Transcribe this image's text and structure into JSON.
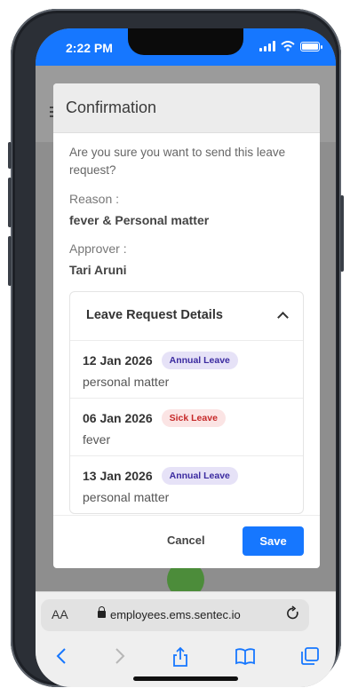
{
  "status_bar": {
    "time": "2:22 PM"
  },
  "modal": {
    "title": "Confirmation",
    "message": "Are you sure you want to send this leave request?",
    "reason_label": "Reason :",
    "reason_value": "fever & Personal matter",
    "approver_label": "Approver :",
    "approver_value": "Tari Aruni",
    "details": {
      "title": "Leave Request Details",
      "items": [
        {
          "date": "12 Jan 2026",
          "type": "Annual Leave",
          "note": "personal matter"
        },
        {
          "date": "06 Jan 2026",
          "type": "Sick Leave",
          "note": "fever"
        },
        {
          "date": "13 Jan 2026",
          "type": "Annual Leave",
          "note": "personal matter"
        }
      ]
    },
    "cancel_label": "Cancel",
    "save_label": "Save"
  },
  "browser": {
    "aa_label": "AA",
    "url": "employees.ems.sentec.io"
  },
  "colors": {
    "accent": "#1677ff",
    "annual_badge": "#e6e2f7",
    "sick_badge": "#fbe4e4"
  },
  "icons": [
    "signal-icon",
    "wifi-icon",
    "battery-icon",
    "lock-icon",
    "reload-icon",
    "back-icon",
    "forward-icon",
    "share-icon",
    "bookmarks-icon",
    "tabs-icon",
    "chevron-up-icon"
  ]
}
